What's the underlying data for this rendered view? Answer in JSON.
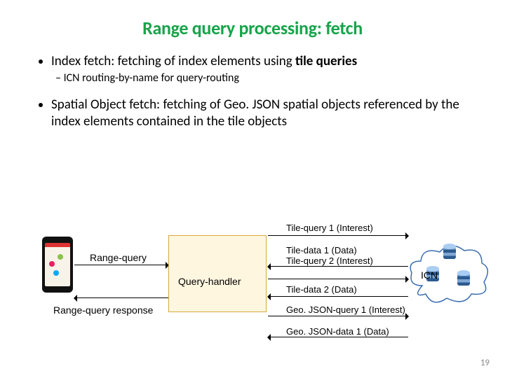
{
  "title": "Range query processing: fetch",
  "bullet1": {
    "pre": "Index fetch: fetching of index elements using ",
    "bold": "tile queries",
    "sub1": "ICN routing-by-name for query-routing"
  },
  "bullet2": "Spatial Object fetch: fetching of Geo. JSON spatial objects referenced by the index elements contained in the tile objects",
  "labels": {
    "range_query": "Range-query",
    "range_query_response": "Range-query response",
    "query_handler": "Query-handler",
    "icn": "ICN"
  },
  "messages": {
    "tile_query_1": "Tile-query 1 (Interest)",
    "tile_data_1": "Tile-data 1 (Data)",
    "tile_query_2": "Tile-query 2 (Interest)",
    "tile_data_2": "Tile-data 2 (Data)",
    "geojson_query_1": "Geo. JSON-query 1 (Interest)",
    "geojson_data_1": "Geo. JSON-data 1 (Data)"
  },
  "page_number": "19"
}
